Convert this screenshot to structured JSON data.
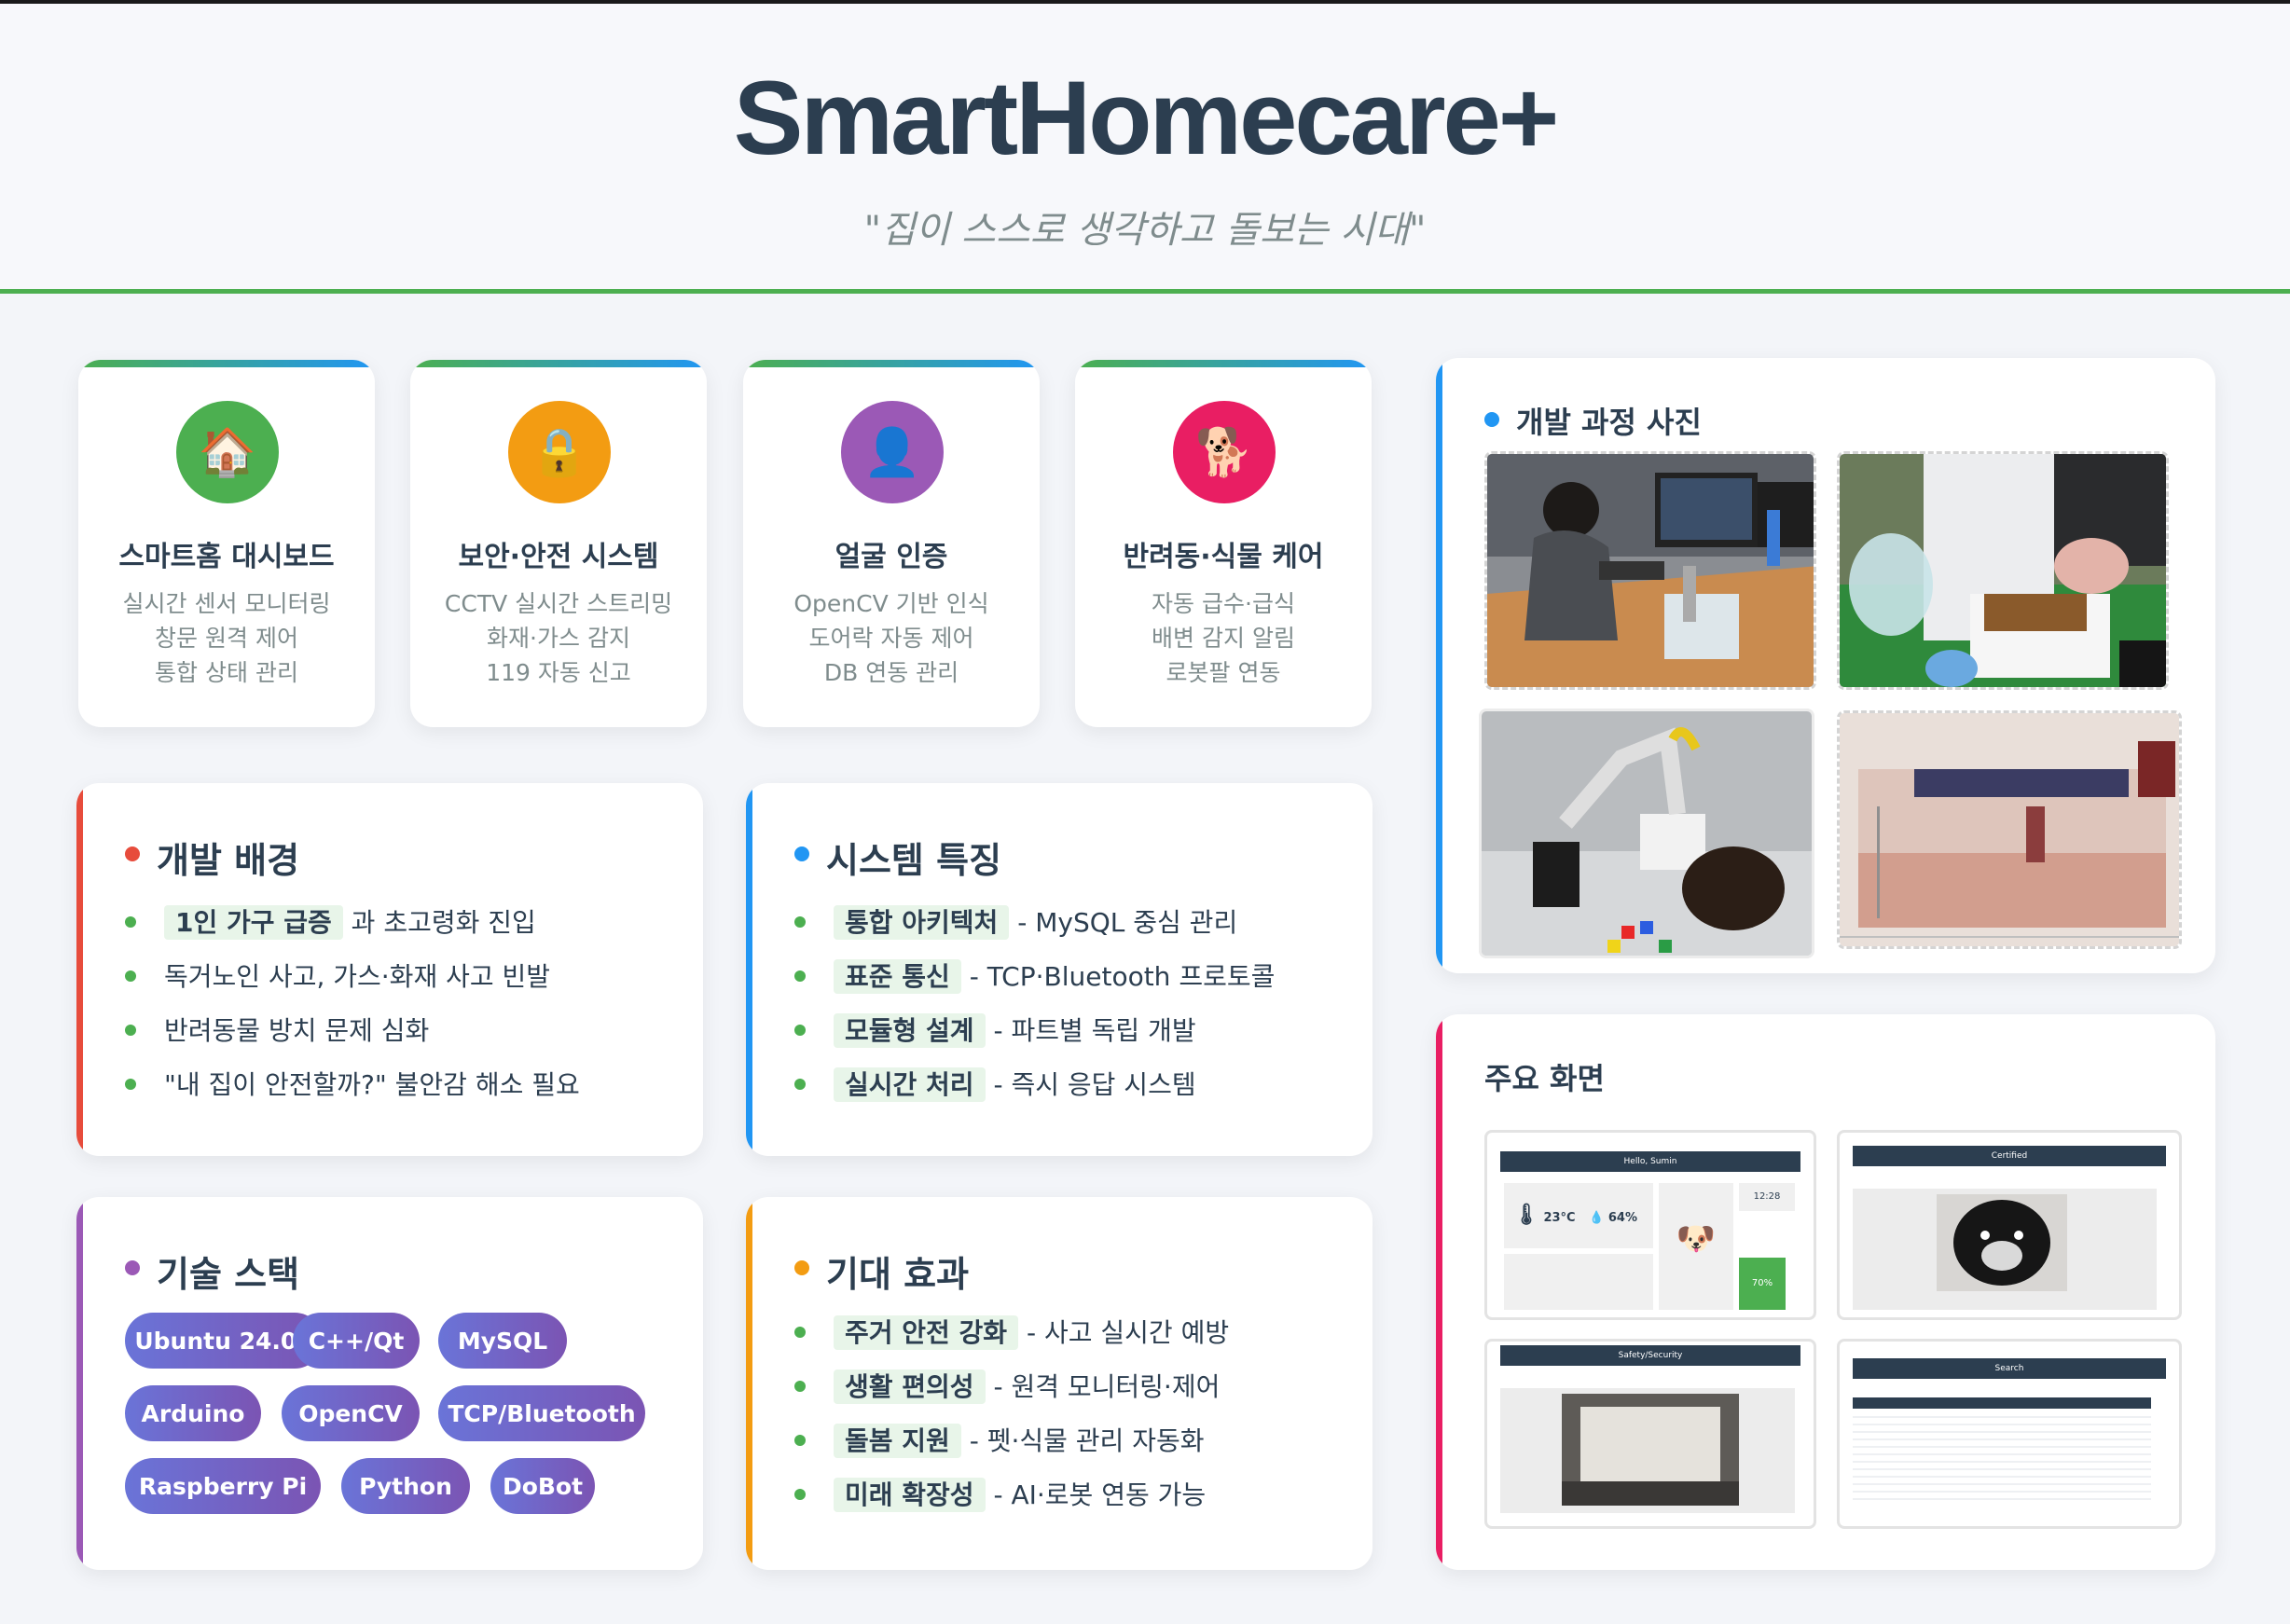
{
  "header": {
    "title": "SmartHomecare+",
    "subtitle": "\"집이 스스로 생각하고 돌보는 시대\""
  },
  "features": [
    {
      "icon": "house-icon",
      "glyph": "🏠",
      "color": "#4caf50",
      "title": "스마트홈 대시보드",
      "lines": [
        "실시간 센서 모니터링",
        "창문 원격 제어",
        "통합 상태 관리"
      ]
    },
    {
      "icon": "lock-icon",
      "glyph": "🔒",
      "color": "#f39c12",
      "title": "보안·안전 시스템",
      "lines": [
        "CCTV 실시간 스트리밍",
        "화재·가스 감지",
        "119 자동 신고"
      ]
    },
    {
      "icon": "person-icon",
      "glyph": "👤",
      "color": "#9b59b6",
      "title": "얼굴 인증",
      "lines": [
        "OpenCV 기반 인식",
        "도어락 자동 제어",
        "DB 연동 관리"
      ]
    },
    {
      "icon": "dog-icon",
      "glyph": "🐕",
      "color": "#e91e63",
      "title": "반려동·식물 케어",
      "lines": [
        "자동 급수·급식",
        "배변 감지 알림",
        "로봇팔 연동"
      ]
    }
  ],
  "background": {
    "title": "개발 배경",
    "color": "#e74c3c",
    "items": [
      {
        "hl": "1인 가구 급증",
        "text": " 과 초고령화 진입"
      },
      {
        "hl": "",
        "text": "독거노인 사고, 가스·화재 사고 빈발"
      },
      {
        "hl": "",
        "text": "반려동물 방치 문제 심화"
      },
      {
        "hl": "",
        "text": "\"내 집이 안전할까?\" 불안감 해소 필요"
      }
    ]
  },
  "system": {
    "title": "시스템 특징",
    "color": "#2196f3",
    "items": [
      {
        "hl": "통합 아키텍처",
        "text": " - MySQL 중심 관리"
      },
      {
        "hl": "표준 통신",
        "text": " - TCP·Bluetooth 프로토콜"
      },
      {
        "hl": "모듈형 설계",
        "text": " - 파트별 독립 개발"
      },
      {
        "hl": "실시간 처리",
        "text": " - 즉시 응답 시스템"
      }
    ]
  },
  "techstack": {
    "title": "기술 스택",
    "color": "#9b59b6",
    "pills": [
      "Ubuntu 24.04",
      "C++/Qt",
      "MySQL",
      "Arduino",
      "OpenCV",
      "TCP/Bluetooth",
      "Raspberry Pi",
      "Python",
      "DoBot"
    ]
  },
  "effects": {
    "title": "기대 효과",
    "color": "#f39c12",
    "items": [
      {
        "hl": "주거 안전 강화",
        "text": " - 사고 실시간 예방"
      },
      {
        "hl": "생활 편의성",
        "text": " - 원격 모니터링·제어"
      },
      {
        "hl": "돌봄 지원",
        "text": " - 펫·식물 관리 자동화"
      },
      {
        "hl": "미래 확장성",
        "text": " - AI·로봇 연동 가능"
      }
    ]
  },
  "photos": {
    "title": "개발 과정 사진",
    "color": "#2196f3"
  },
  "screens": {
    "title": "주요 화면",
    "color": "#e91e63",
    "dashboard": {
      "greeting": "Hello, Sumin",
      "temp": "23°C",
      "humidity": "64%",
      "time": "12:28",
      "percent": "70%"
    },
    "certified": "Certified",
    "security": "Safety/Security",
    "search": "Search"
  }
}
